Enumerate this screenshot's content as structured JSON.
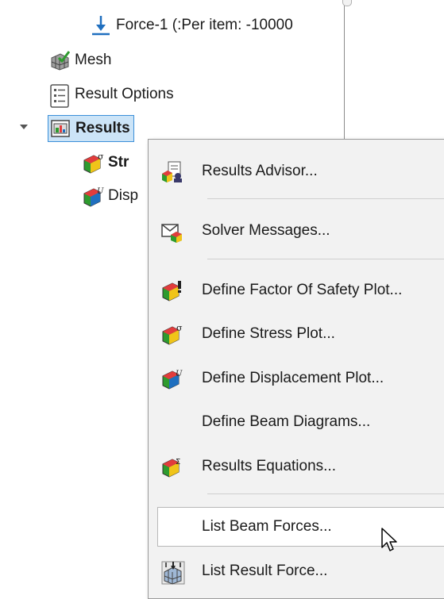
{
  "tree": {
    "items": [
      {
        "label": "Force-1 (:Per item: -10000",
        "icon": "force-arrow-icon"
      },
      {
        "label": "Mesh",
        "icon": "mesh-icon"
      },
      {
        "label": "Result Options",
        "icon": "result-options-icon"
      },
      {
        "label": "Results",
        "icon": "results-folder-icon"
      },
      {
        "label": "Str",
        "icon": "stress-plot-icon"
      },
      {
        "label": "Disp",
        "icon": "displacement-plot-icon"
      }
    ]
  },
  "context_menu": {
    "items": [
      {
        "label": "Results Advisor...",
        "icon": "results-advisor-icon"
      },
      {
        "label": "Solver Messages...",
        "icon": "solver-messages-icon"
      },
      {
        "label": "Define Factor Of Safety Plot...",
        "icon": "factor-of-safety-icon"
      },
      {
        "label": "Define Stress Plot...",
        "icon": "stress-plot-icon"
      },
      {
        "label": "Define Displacement Plot...",
        "icon": "displacement-plot-icon"
      },
      {
        "label": "Define Beam Diagrams...",
        "icon": ""
      },
      {
        "label": "Results Equations...",
        "icon": "results-equations-icon"
      },
      {
        "label": "List Beam Forces...",
        "icon": ""
      },
      {
        "label": "List Result Force...",
        "icon": "list-result-force-icon"
      }
    ],
    "hovered_item": "List Beam Forces..."
  },
  "colors": {
    "selection_bg": "#cce4f7",
    "selection_border": "#3b8fd9",
    "menu_bg": "#f2f2f2",
    "force_arrow": "#1f6fbf"
  }
}
